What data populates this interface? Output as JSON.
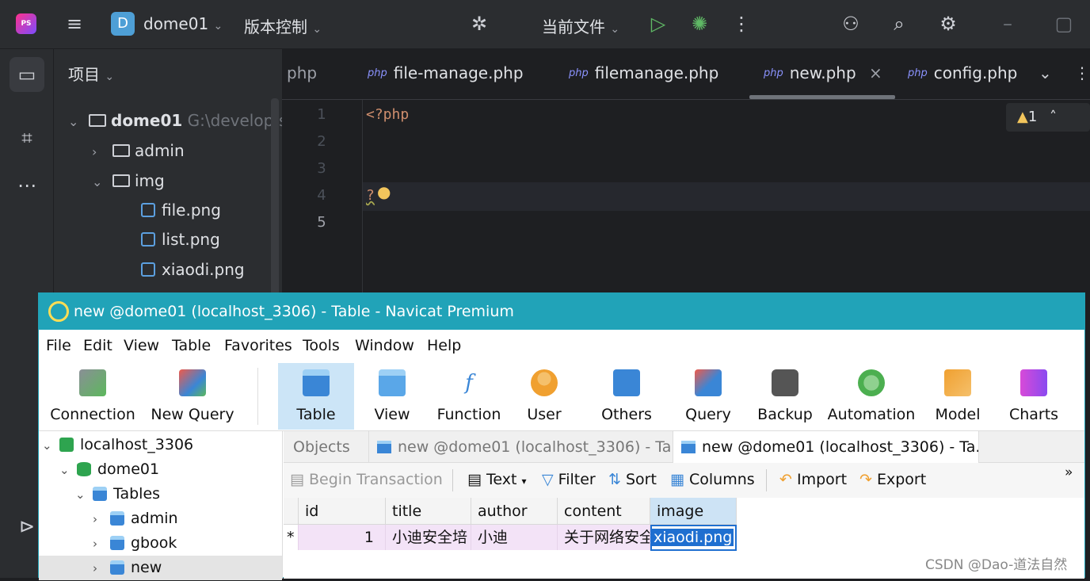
{
  "ide": {
    "project_badge": "D",
    "project_name": "dome01",
    "vcs": "版本控制",
    "run_config": "当前文件",
    "panel_title": "项目",
    "tree": [
      {
        "label": "dome01",
        "path": "G:\\develop\\s"
      },
      {
        "label": "admin"
      },
      {
        "label": "img"
      },
      {
        "label": "file.png"
      },
      {
        "label": "list.png"
      },
      {
        "label": "xiaodi.png"
      }
    ],
    "tabs": [
      {
        "label": "php"
      },
      {
        "label": "file-manage.php"
      },
      {
        "label": "filemanage.php"
      },
      {
        "label": "new.php"
      },
      {
        "label": "config.php"
      }
    ],
    "php_tag": "php",
    "warning_count": "1",
    "line_numbers": [
      "1",
      "2",
      "3",
      "4",
      "5"
    ],
    "code_lines": [
      "<?php",
      "",
      "",
      "?",
      ""
    ]
  },
  "navicat": {
    "title": "new @dome01 (localhost_3306) - Table - Navicat Premium",
    "menu": [
      "File",
      "Edit",
      "View",
      "Table",
      "Favorites",
      "Tools",
      "Window",
      "Help"
    ],
    "toolbar": [
      "Connection",
      "New Query",
      "Table",
      "View",
      "Function",
      "User",
      "Others",
      "Query",
      "Backup",
      "Automation",
      "Model",
      "Charts"
    ],
    "nav": {
      "connection": "localhost_3306",
      "database": "dome01",
      "group": "Tables",
      "tables": [
        "admin",
        "gbook",
        "new"
      ]
    },
    "tabs": [
      "Objects",
      "new @dome01 (localhost_3306) - Ta...",
      "new @dome01 (localhost_3306) - Ta..."
    ],
    "actions": [
      "Begin Transaction",
      "Text",
      "Filter",
      "Sort",
      "Columns",
      "Import",
      "Export"
    ],
    "overflow": "»",
    "columns": [
      "id",
      "title",
      "author",
      "content",
      "image"
    ],
    "row": {
      "marker": "*",
      "id": "1",
      "title": "小迪安全培",
      "author": "小迪",
      "content": "关于网络安全",
      "image": "xiaodi.png"
    }
  },
  "watermark": "CSDN @Dao-道法自然"
}
